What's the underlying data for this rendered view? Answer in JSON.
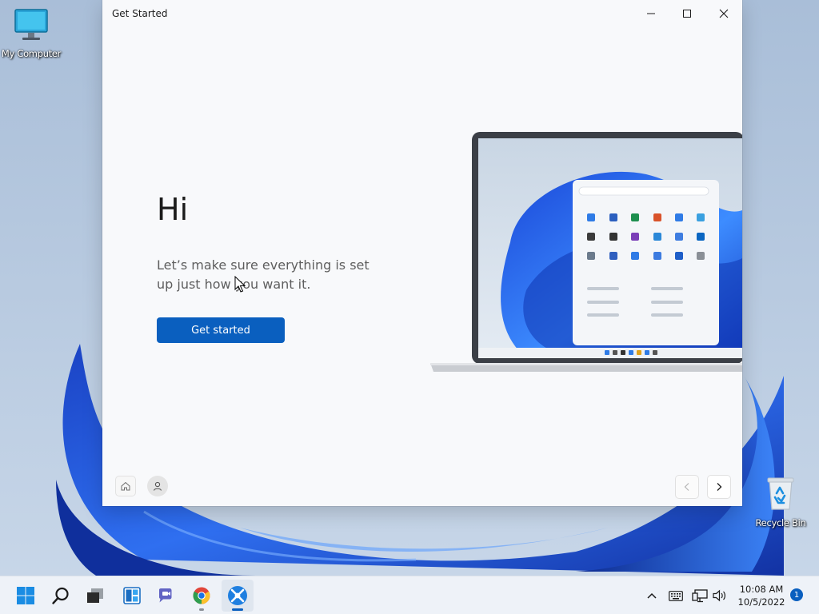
{
  "desktop": {
    "icons": [
      {
        "label": "My Computer",
        "icon": "monitor-icon"
      },
      {
        "label": "Recycle Bin",
        "icon": "recycle-bin-icon"
      }
    ]
  },
  "window": {
    "title": "Get Started",
    "controls": {
      "minimize": "minimize-icon",
      "maximize": "maximize-icon",
      "close": "close-icon"
    },
    "heading": "Hi",
    "subtitle": "Let’s make sure everything is set up just how you want it.",
    "primary_button": "Get started",
    "footer": {
      "home": "home-icon",
      "profile": "profile-icon",
      "back": "chevron-left-icon",
      "next": "chevron-right-icon"
    }
  },
  "taskbar": {
    "pinned": [
      {
        "name": "start",
        "icon": "windows-logo-icon"
      },
      {
        "name": "search",
        "icon": "search-icon"
      },
      {
        "name": "task-view",
        "icon": "task-view-icon"
      },
      {
        "name": "widgets",
        "icon": "widgets-icon"
      },
      {
        "name": "chat",
        "icon": "teams-chat-icon"
      },
      {
        "name": "chrome",
        "icon": "chrome-icon"
      },
      {
        "name": "get-started",
        "icon": "get-started-icon"
      }
    ],
    "tray": [
      "chevron-up-icon",
      "keyboard-icon",
      "network-icon",
      "volume-icon"
    ],
    "time": "10:08 AM",
    "date": "10/5/2022",
    "notifications": "1"
  },
  "colors": {
    "accent": "#0a5fbf",
    "wallpaper_blue": "#1f55d6"
  }
}
